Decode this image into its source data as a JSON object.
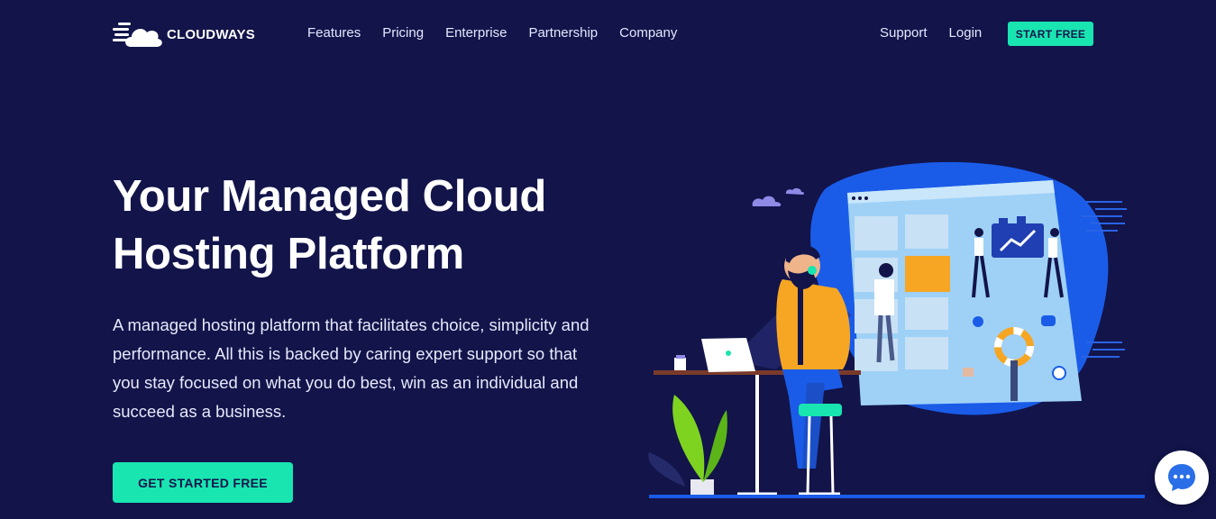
{
  "brand": {
    "name": "CLOUDWAYS"
  },
  "nav": {
    "links": [
      "Features",
      "Pricing",
      "Enterprise",
      "Partnership",
      "Company"
    ],
    "support": "Support",
    "login": "Login",
    "start_free": "START FREE"
  },
  "hero": {
    "title": "Your Managed Cloud Hosting Platform",
    "description": "A managed hosting platform that facilitates choice, simplicity and performance. All this is backed by caring expert support so that you stay focused on what you do best, win as an individual and succeed as a business.",
    "cta": "GET STARTED FREE"
  },
  "icons": {
    "logo": "cloud-logo-icon",
    "chat": "chat-bubble-icon"
  },
  "colors": {
    "background": "#12144a",
    "accent": "#19e5b1",
    "blob": "#1a5ce8",
    "screen": "#9fd1f7"
  }
}
